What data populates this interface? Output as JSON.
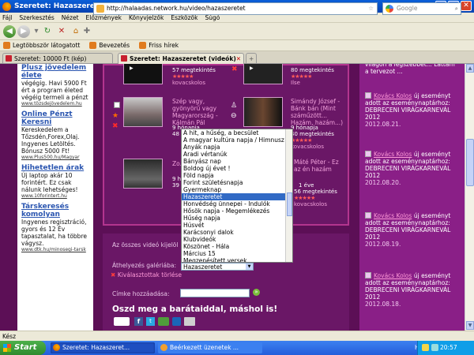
{
  "window": {
    "title": "Szeretet: Hazaszeretet (videók) - Mozilla Firefox"
  },
  "menu": [
    "Fájl",
    "Szerkesztés",
    "Nézet",
    "Előzmények",
    "Könyvjelzők",
    "Eszközök",
    "Súgó"
  ],
  "nav": {
    "url": "http://halaadas.network.hu/video/hazaszeretet",
    "search_placeholder": "Google"
  },
  "bookmarks": [
    "Legtöbbször látogatott",
    "Bevezetés",
    "Friss hírek"
  ],
  "tabs": [
    {
      "label": "Szeretet: 10000 Ft (kép)"
    },
    {
      "label": "Szeretet: Hazaszeretet (videók)"
    }
  ],
  "ads": [
    {
      "title": "Plusz jövedelem élete",
      "desc": "végégig. Havi 5900 Ft ért a program életed végéig termeli a pénzt",
      "url": "www.tözsdejövedelem.hu"
    },
    {
      "title": "Online Pénzt Keresni",
      "desc": "Kereskedelem a Tőzsdén,Forex,Olaj. Ingyenes Letöltés. Bónusz 5000 Ft!",
      "url": "www.Plus500.hu/Magyar"
    },
    {
      "title": "Hihetetlen árak",
      "desc": "Új laptop akár 10 forintért. Ez csak nálunk lehetséges!",
      "url": "www.10forintert.hu"
    },
    {
      "title": "Társkeresés komolyan",
      "desc": "Ingyenes regisztráció, gyors és 12 Év tapasztalat, ha többre vágysz.",
      "url": "www.dtk.hu/minosegi-tarsk"
    }
  ],
  "videos": {
    "row0_left_views": "57 megtekintés",
    "row0_left_user": "kovacskolos",
    "row0_right_views": "80 megtekintés",
    "row0_right_user": "Ilse",
    "v1_title": "Szép vagy, gyönyörű vagy Magyarország - Kálmán Pál",
    "v1_date": "9 hónapja",
    "v1_views": "48 megtekintés",
    "v2_title": "Simándy József - Bánk bán (Mint száműzött... Hazám, hazám...)",
    "v2_date": "9 hónapja",
    "v2_views": "40 megtekintés",
    "v2_user": "kovacskolos",
    "v3_title": "Zo...",
    "v3_date": "9 h",
    "v3_views": "39",
    "v4_title": "Máté Péter - Ez az én hazám",
    "v4_date": "1 éve",
    "v4_views": "56 megtekintés",
    "v4_user": "kovacskolos"
  },
  "panel": {
    "select_all": "Az összes videó kijelöl",
    "move_label": "Áthelyezés galériába:",
    "delete_label": "Kiválasztottak törlése",
    "tag_label": "Címke hozzáadása:",
    "share_text": "Oszd meg a barátaiddal, máshol is!",
    "select_value": "Hazaszeretet"
  },
  "dropdown_options": [
    "A hit, a hűség, a becsület",
    "A magyar kultúra napja / Himnusz",
    "Anyák napja",
    "Aradi vértanúk",
    "Bányász nap",
    "Boldog új évet !",
    "Föld napja",
    "Forint születésnapja",
    "Gyermeknap",
    "Hazaszeretet",
    "Honvédség ünnepei - Indulók",
    "Hősök napja - Megemlékezés",
    "Hűség napja",
    "Húsvét",
    "Karácsonyi dalok",
    "Klubvideók",
    "Köszönet - Hála",
    "Március 15",
    "Megzenésített versek",
    "Mindenszentek - Halottak napja"
  ],
  "dropdown_selected_index": 9,
  "feed": {
    "top_text": "világon a legszebbet... Lattam a tervezot ...",
    "items": [
      {
        "user": "Kovács Kolos",
        "text": "új eseményt adott az eseménynaptárhoz: DEBRECENI VIRÁGKARNEVÁL 2012",
        "date": "2012.08.21."
      },
      {
        "user": "Kovács Kolos",
        "text": "új eseményt adott az eseménynaptárhoz: DEBRECENI VIRÁGKARNEVÁL 2012",
        "date": "2012.08.20."
      },
      {
        "user": "Kovács Kolos",
        "text": "új eseményt adott az eseménynaptárhoz: DEBRECENI VIRÁGKARNEVÁL 2012",
        "date": "2012.08.19."
      },
      {
        "user": "Kovács Kolos",
        "text": "új eseményt adott az eseménynaptárhoz: DEBRECENI VIRÁGKARNEVÁL 2012",
        "date": "2012.08.18."
      }
    ]
  },
  "status": "Kész",
  "taskbar": {
    "start": "Start",
    "tasks": [
      "Szeretet: Hazaszeret...",
      "Beérkezett üzenetek ..."
    ],
    "lang": "HU",
    "time": "20:57"
  }
}
